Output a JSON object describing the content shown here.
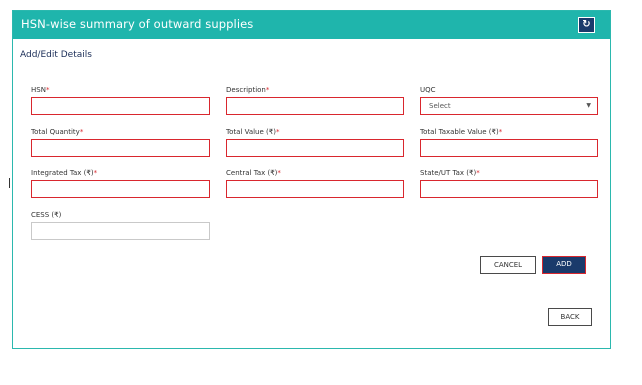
{
  "header": {
    "title": "HSN-wise summary of outward supplies"
  },
  "form": {
    "section_title": "Add/Edit Details",
    "required_mark": "*",
    "fields": {
      "hsn": {
        "label": "HSN"
      },
      "description": {
        "label": "Description"
      },
      "uqc": {
        "label": "UQC",
        "value": "Select"
      },
      "total_quantity": {
        "label": "Total Quantity"
      },
      "total_value": {
        "label": "Total Value (₹)"
      },
      "total_taxable_value": {
        "label": "Total Taxable Value (₹)"
      },
      "integrated_tax": {
        "label": "Integrated Tax (₹)"
      },
      "central_tax": {
        "label": "Central Tax (₹)"
      },
      "state_ut_tax": {
        "label": "State/UT Tax (₹)"
      },
      "cess": {
        "label": "CESS (₹)"
      }
    }
  },
  "actions": {
    "cancel_label": "CANCEL",
    "add_label": "ADD",
    "back_label": "BACK"
  },
  "icons": {
    "refresh": "refresh-icon"
  },
  "colors": {
    "header_bg": "#1fb5ac",
    "required_red": "#d9272e",
    "primary_navy": "#1a3a6b"
  }
}
